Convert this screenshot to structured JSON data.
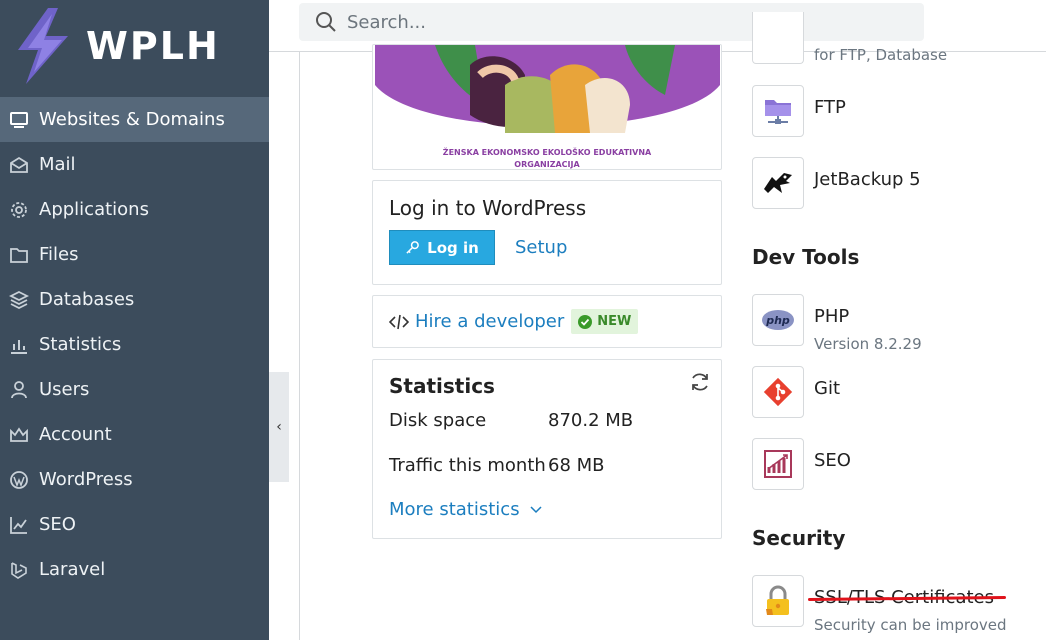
{
  "logo": {
    "text": "WPLH"
  },
  "search": {
    "placeholder": "Search..."
  },
  "sidebar": {
    "items": [
      {
        "label": "Websites & Domains",
        "icon": "monitor-icon",
        "active": true
      },
      {
        "label": "Mail",
        "icon": "mail-icon"
      },
      {
        "label": "Applications",
        "icon": "gear-icon"
      },
      {
        "label": "Files",
        "icon": "folder-icon"
      },
      {
        "label": "Databases",
        "icon": "layers-icon"
      },
      {
        "label": "Statistics",
        "icon": "bar-chart-icon"
      },
      {
        "label": "Users",
        "icon": "user-icon"
      },
      {
        "label": "Account",
        "icon": "crown-icon"
      },
      {
        "label": "WordPress",
        "icon": "wordpress-icon"
      },
      {
        "label": "SEO",
        "icon": "seo-icon"
      },
      {
        "label": "Laravel",
        "icon": "laravel-icon"
      }
    ]
  },
  "preview": {
    "caption_line1": "ŽENSKA EKONOMSKO EKOLOŠKO EDUKATIVNA",
    "caption_line2": "ORGANIZACIJA"
  },
  "wordpress": {
    "title": "Log in to WordPress",
    "login_label": "Log in",
    "setup_label": "Setup"
  },
  "hire": {
    "label": "Hire a developer",
    "badge": "NEW"
  },
  "statistics": {
    "title": "Statistics",
    "rows": [
      {
        "label": "Disk space",
        "value": "870.2 MB"
      },
      {
        "label": "Traffic this month",
        "value": "68 MB"
      }
    ],
    "more_label": "More statistics"
  },
  "tools": {
    "cut_sub": "for FTP, Database",
    "ftp": {
      "name": "FTP"
    },
    "jetbackup": {
      "name": "JetBackup 5"
    },
    "dev_tools_title": "Dev Tools",
    "php": {
      "name": "PHP",
      "sub": "Version 8.2.29"
    },
    "git": {
      "name": "Git"
    },
    "seo": {
      "name": "SEO"
    },
    "security_title": "Security",
    "ssl": {
      "name": "SSL/TLS Certificates",
      "sub": "Security can be improved"
    }
  },
  "colors": {
    "sidebar_bg": "#3c4c5c",
    "sidebar_active": "#56687a",
    "primary": "#28a8e0",
    "link": "#1c7ebf",
    "badge_bg": "#e2f4dc",
    "annotation_red": "#e0131b"
  }
}
